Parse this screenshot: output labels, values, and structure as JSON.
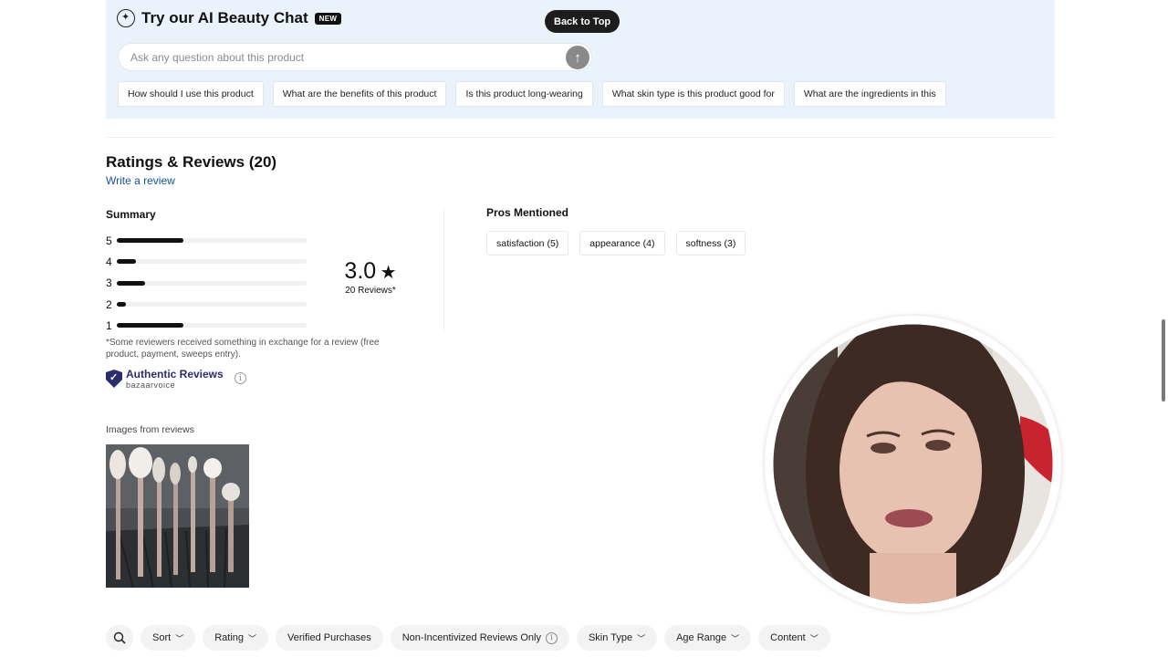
{
  "ai_chat": {
    "title": "Try our AI Beauty Chat",
    "badge": "NEW",
    "back_to_top": "Back to Top",
    "input_placeholder": "Ask any question about this product",
    "suggestions": [
      "How should I use this product",
      "What are the benefits of this product",
      "Is this product long-wearing",
      "What skin type is this product good for",
      "What are the ingredients in this"
    ]
  },
  "reviews": {
    "title": "Ratings & Reviews (20)",
    "write_review": "Write a review",
    "summary_label": "Summary",
    "histogram": [
      {
        "stars": "5",
        "fraction": 0.35
      },
      {
        "stars": "4",
        "fraction": 0.1
      },
      {
        "stars": "3",
        "fraction": 0.15
      },
      {
        "stars": "2",
        "fraction": 0.05
      },
      {
        "stars": "1",
        "fraction": 0.35
      }
    ],
    "average": "3.0",
    "average_star": "★",
    "review_count": "20 Reviews*",
    "incentive_note": "*Some reviewers received something in exchange for a review (free product, payment, sweeps entry).",
    "authentic_title": "Authentic Reviews",
    "authentic_sub": "bazaarvoice",
    "pros_label": "Pros Mentioned",
    "pros": [
      "satisfaction (5)",
      "appearance (4)",
      "softness (3)"
    ],
    "images_label": "Images from reviews"
  },
  "filters": {
    "items": [
      {
        "label": "Sort",
        "chevron": true
      },
      {
        "label": "Rating",
        "chevron": true
      },
      {
        "label": "Verified Purchases",
        "chevron": false
      },
      {
        "label": "Non-Incentivized Reviews Only",
        "chevron": false,
        "info": true
      },
      {
        "label": "Skin Type",
        "chevron": true
      },
      {
        "label": "Age Range",
        "chevron": true
      },
      {
        "label": "Content",
        "chevron": true
      }
    ]
  },
  "colors": {
    "panel_bg": "#eaf3fb",
    "link": "#1a4fa8",
    "brand_badge": "#2b2d6e"
  }
}
